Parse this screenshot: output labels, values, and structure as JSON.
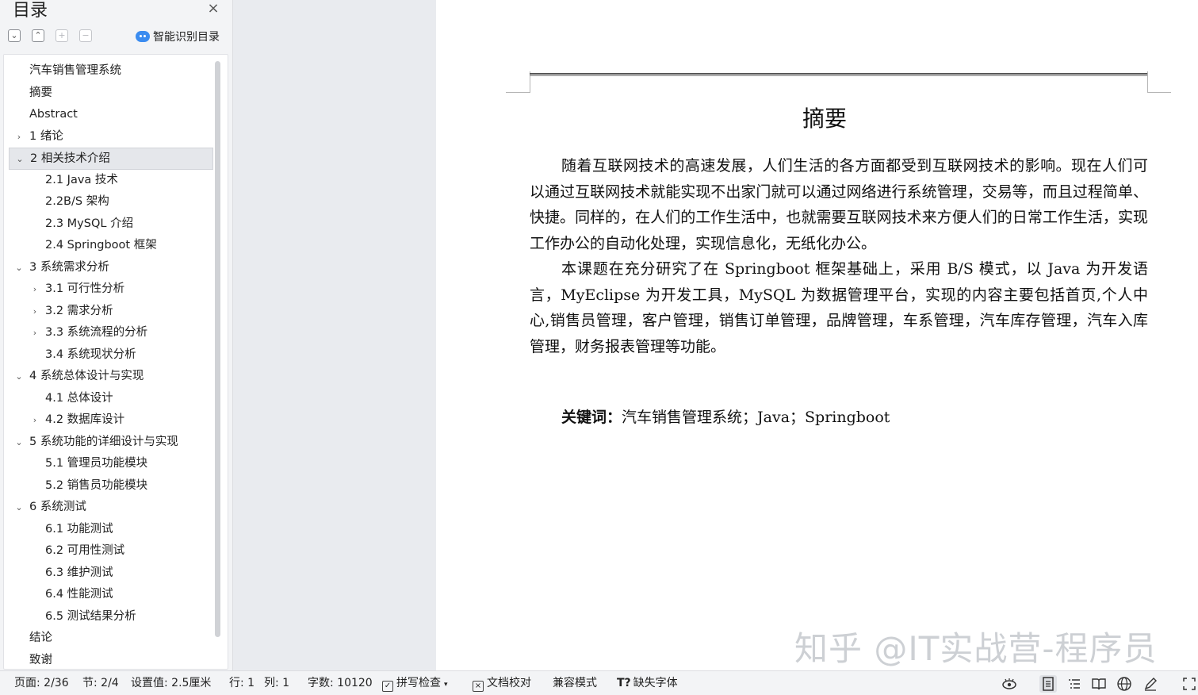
{
  "sidebar": {
    "title": "目录",
    "close": "×",
    "smart_toc": "智能识别目录",
    "toolbar": [
      "⌄",
      "⌃",
      "+",
      "−"
    ],
    "items": [
      {
        "label": "汽车销售管理系统",
        "level": 1,
        "chevron": ""
      },
      {
        "label": "摘要",
        "level": 1,
        "chevron": ""
      },
      {
        "label": "Abstract",
        "level": 1,
        "chevron": ""
      },
      {
        "label": "1  绪论",
        "level": 1,
        "chevron": "›"
      },
      {
        "label": "2 相关技术介绍",
        "level": 1,
        "chevron": "⌄",
        "active": true
      },
      {
        "label": "2.1 Java 技术",
        "level": 2,
        "chevron": ""
      },
      {
        "label": "2.2B/S 架构",
        "level": 2,
        "chevron": ""
      },
      {
        "label": "2.3 MySQL 介绍",
        "level": 2,
        "chevron": ""
      },
      {
        "label": "2.4 Springboot 框架",
        "level": 2,
        "chevron": ""
      },
      {
        "label": "3 系统需求分析",
        "level": 1,
        "chevron": "⌄"
      },
      {
        "label": "3.1  可行性分析",
        "level": 2,
        "chevron": "›"
      },
      {
        "label": "3.2  需求分析",
        "level": 2,
        "chevron": "›"
      },
      {
        "label": "3.3 系统流程的分析",
        "level": 2,
        "chevron": "›"
      },
      {
        "label": "3.4  系统现状分析",
        "level": 2,
        "chevron": ""
      },
      {
        "label": "4 系统总体设计与实现",
        "level": 1,
        "chevron": "⌄"
      },
      {
        "label": "4.1  总体设计",
        "level": 2,
        "chevron": ""
      },
      {
        "label": "4.2  数据库设计",
        "level": 2,
        "chevron": "›"
      },
      {
        "label": "5  系统功能的详细设计与实现",
        "level": 1,
        "chevron": "⌄"
      },
      {
        "label": "5.1  管理员功能模块",
        "level": 2,
        "chevron": ""
      },
      {
        "label": "5.2  销售员功能模块",
        "level": 2,
        "chevron": ""
      },
      {
        "label": "6  系统测试",
        "level": 1,
        "chevron": "⌄"
      },
      {
        "label": "6.1  功能测试",
        "level": 2,
        "chevron": ""
      },
      {
        "label": "6.2  可用性测试",
        "level": 2,
        "chevron": ""
      },
      {
        "label": "6.3  维护测试",
        "level": 2,
        "chevron": ""
      },
      {
        "label": "6.4  性能测试",
        "level": 2,
        "chevron": ""
      },
      {
        "label": "6.5  测试结果分析",
        "level": 2,
        "chevron": ""
      },
      {
        "label": "结论",
        "level": 1,
        "chevron": ""
      },
      {
        "label": "致谢",
        "level": 1,
        "chevron": ""
      }
    ]
  },
  "document": {
    "heading": "摘要",
    "paragraphs": [
      "随着互联网技术的高速发展，人们生活的各方面都受到互联网技术的影响。现在人们可以通过互联网技术就能实现不出家门就可以通过网络进行系统管理，交易等，而且过程简单、快捷。同样的，在人们的工作生活中，也就需要互联网技术来方便人们的日常工作生活，实现工作办公的自动化处理，实现信息化，无纸化办公。",
      "本课题在充分研究了在 Springboot 框架基础上，采用 B/S 模式，以 Java 为开发语言，MyEclipse 为开发工具，MySQL 为数据管理平台，实现的内容主要包括首页,个人中心,销售员管理，客户管理，销售订单管理，品牌管理，车系管理，汽车库存管理，汽车入库管理，财务报表管理等功能。"
    ],
    "keywords_label": "关键词：",
    "keywords_text": "汽车销售管理系统；Java；Springboot",
    "watermark": "知乎 @IT实战营-程序员"
  },
  "statusbar": {
    "page": "页面: 2/36",
    "section": "节: 2/4",
    "setting": "设置值: 2.5厘米",
    "row": "行: 1",
    "col": "列: 1",
    "word_count": "字数: 10120",
    "spell_check": "拼写检查",
    "proofread": "文档校对",
    "compat_mode": "兼容模式",
    "missing_font": "缺失字体"
  }
}
